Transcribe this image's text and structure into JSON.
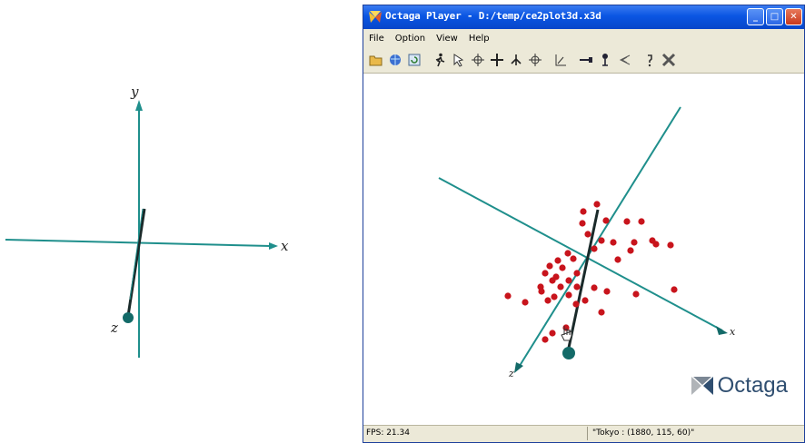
{
  "left_figure": {
    "labels": {
      "x": "x",
      "y": "y",
      "z": "z"
    },
    "axis_color": "#1f8f8c"
  },
  "window": {
    "title": "Octaga Player - D:/temp/ce2plot3d.x3d",
    "title_buttons": [
      "minimize-icon",
      "maximize-icon",
      "close-icon"
    ],
    "menu": [
      "File",
      "Option",
      "View",
      "Help"
    ],
    "toolbar_icons": [
      "open-file-icon",
      "open-url-icon",
      "reload-icon",
      "walk-icon",
      "pointer-icon",
      "examine-icon",
      "pan-icon",
      "fly-icon",
      "center-icon",
      "level-icon",
      "straighten-icon",
      "headlight-icon",
      "collision-icon",
      "info-icon",
      "settings-icon"
    ],
    "axis_labels": {
      "x": "x",
      "z": "z"
    },
    "brand": "Octaga",
    "status": {
      "fps": "FPS: 21.34",
      "selection": "\"Tokyo : (1880, 115, 60)\""
    },
    "colors": {
      "titlebar": "#0a55e3",
      "chrome": "#ece9d8",
      "axis": "#1f8f8c",
      "point": "#c8141c"
    }
  }
}
